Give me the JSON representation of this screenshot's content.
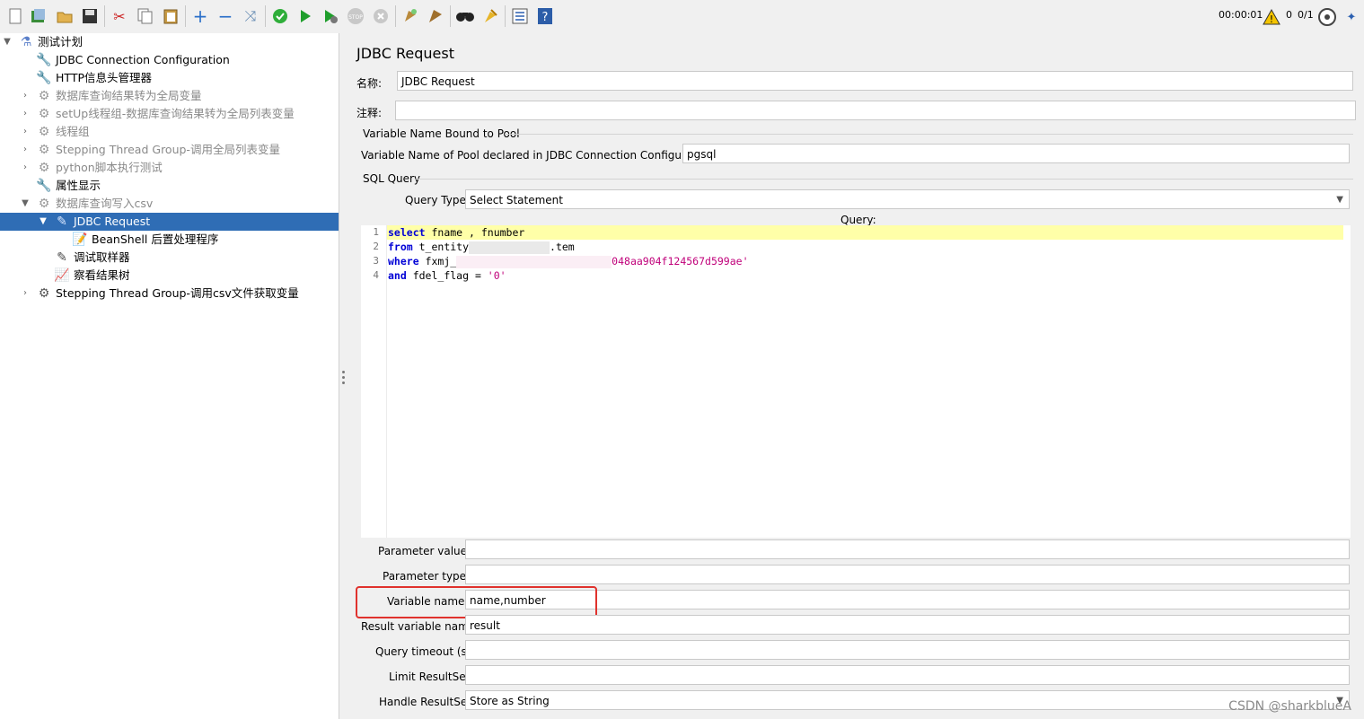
{
  "toolbar": {
    "buttons": [
      "new-icon",
      "templates-icon",
      "open-icon",
      "save-icon",
      "cut-icon",
      "copy-icon",
      "paste-icon",
      "expand-icon",
      "collapse-icon",
      "toggle-icon",
      "validate-icon",
      "start-icon",
      "start-no-pause-icon",
      "stop-icon",
      "shutdown-icon",
      "clear-icon",
      "clear-all-icon",
      "search-icon",
      "reset-search-icon",
      "function-helper-icon",
      "help-icon"
    ],
    "elapsed": "00:00:01",
    "warnings": "0",
    "threads": "0/1"
  },
  "tree": {
    "items": [
      {
        "label": "测试计划"
      },
      {
        "label": "JDBC Connection Configuration"
      },
      {
        "label": "HTTP信息头管理器"
      },
      {
        "label": "数据库查询结果转为全局变量"
      },
      {
        "label": "setUp线程组-数据库查询结果转为全局列表变量"
      },
      {
        "label": "线程组"
      },
      {
        "label": "Stepping Thread Group-调用全局列表变量"
      },
      {
        "label": "python脚本执行测试"
      },
      {
        "label": "属性显示"
      },
      {
        "label": "数据库查询写入csv"
      },
      {
        "label": "JDBC Request"
      },
      {
        "label": "BeanShell 后置处理程序"
      },
      {
        "label": "调试取样器"
      },
      {
        "label": "察看结果树"
      },
      {
        "label": "Stepping Thread Group-调用csv文件获取变量"
      }
    ]
  },
  "panel": {
    "title": "JDBC Request",
    "name_label": "名称:",
    "name_value": "JDBC Request",
    "comment_label": "注释:",
    "comment_value": "",
    "pool_group": "Variable Name Bound to Pool",
    "pool_label": "Variable Name of Pool declared in JDBC Connection Configuration:",
    "pool_value": "pgsql",
    "sql_group": "SQL Query",
    "query_type_label": "Query Type:",
    "query_type_value": "Select Statement",
    "query_label": "Query:",
    "code": {
      "line_numbers": [
        "1",
        "2",
        "3",
        "4"
      ],
      "l1_kw": "select",
      "l1_rest": " fname , fnumber",
      "l2_kw": "from",
      "l2_a": " t_entity",
      "l2_b": ".tem",
      "l3_kw": "where",
      "l3_a": " fxmj_",
      "l3_str": "048aa904f124567d599ae'",
      "l4_kw": "and",
      "l4_a": " fdel_flag = ",
      "l4_str": "'0'"
    },
    "param_values_label": "Parameter values:",
    "param_values": "",
    "param_types_label": "Parameter types:",
    "param_types": "",
    "var_names_label": "Variable names:",
    "var_names": "name,number",
    "result_var_label": "Result variable name:",
    "result_var": "result",
    "timeout_label": "Query timeout (s):",
    "timeout": "",
    "limit_label": "Limit ResultSet:",
    "limit": "",
    "handle_label": "Handle ResultSet:",
    "handle_value": "Store as String"
  },
  "watermark": "CSDN @sharkblueA",
  "colors": {
    "selection": "#2f6db5",
    "highlight_box": "#e0322d",
    "keyword": "#0000d6",
    "string": "#c0007a"
  }
}
